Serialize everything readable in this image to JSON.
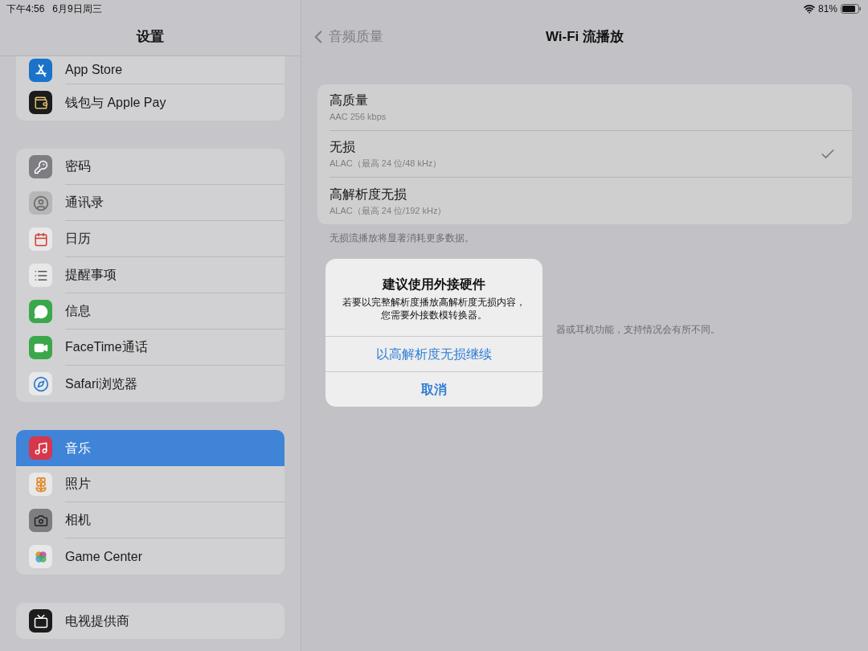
{
  "status_bar": {
    "time": "下午4:56",
    "date": "6月9日周三",
    "battery_percent": "81%"
  },
  "sidebar": {
    "title": "设置",
    "groups": [
      {
        "items": [
          {
            "label": "App Store",
            "selected": false
          },
          {
            "label": "钱包与 Apple Pay",
            "selected": false
          }
        ]
      },
      {
        "items": [
          {
            "label": "密码",
            "selected": false
          },
          {
            "label": "通讯录",
            "selected": false
          },
          {
            "label": "日历",
            "selected": false
          },
          {
            "label": "提醒事项",
            "selected": false
          },
          {
            "label": "信息",
            "selected": false
          },
          {
            "label": "FaceTime通话",
            "selected": false
          },
          {
            "label": "Safari浏览器",
            "selected": false
          }
        ]
      },
      {
        "items": [
          {
            "label": "音乐",
            "selected": true
          },
          {
            "label": "照片",
            "selected": false
          },
          {
            "label": "相机",
            "selected": false
          },
          {
            "label": "Game Center",
            "selected": false
          }
        ]
      },
      {
        "items": [
          {
            "label": "电视提供商",
            "selected": false
          }
        ]
      }
    ]
  },
  "detail": {
    "back_label": "音频质量",
    "title": "Wi-Fi 流播放",
    "options": [
      {
        "title": "高质量",
        "subtitle": "AAC 256 kbps",
        "selected": false
      },
      {
        "title": "无损",
        "subtitle": "ALAC（最高 24 位/48 kHz）",
        "selected": true
      },
      {
        "title": "高解析度无损",
        "subtitle": "ALAC（最高 24 位/192 kHz）",
        "selected": false
      }
    ],
    "footer": "无损流播放将显著消耗更多数据。",
    "partly_hidden_note": "器或耳机功能，支持情况会有所不同。"
  },
  "alert": {
    "title": "建议使用外接硬件",
    "message": "若要以完整解析度播放高解析度无损内容，您需要外接数模转换器。",
    "buttons": [
      {
        "label": "以高解析度无损继续",
        "kind": "default"
      },
      {
        "label": "取消",
        "kind": "cancel"
      }
    ]
  }
}
